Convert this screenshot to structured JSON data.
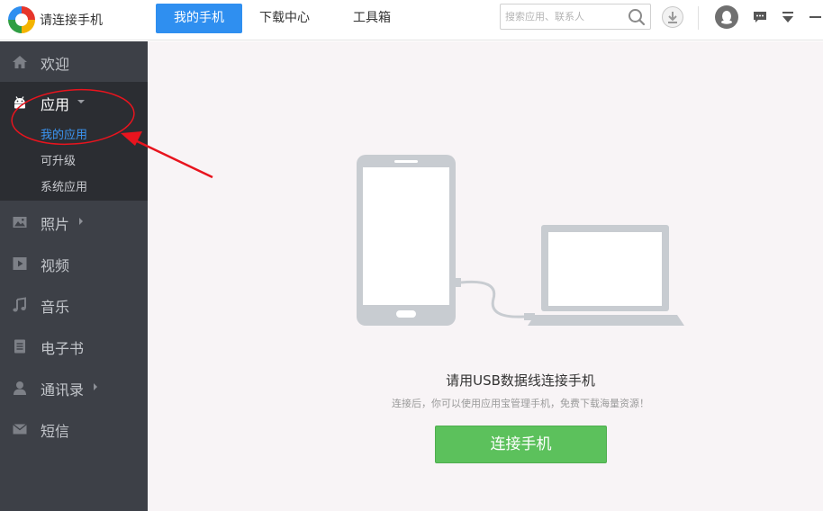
{
  "app": {
    "title": "请连接手机"
  },
  "nav": {
    "tabs": [
      {
        "label": "我的手机",
        "active": true
      },
      {
        "label": "下载中心",
        "active": false
      },
      {
        "label": "工具箱",
        "active": false
      }
    ]
  },
  "search": {
    "placeholder": "搜索应用、联系人",
    "icon": "search-icon"
  },
  "header_icons": [
    "download-icon",
    "qq-avatar-icon",
    "message-icon",
    "dropdown-menu-icon",
    "minimize-icon"
  ],
  "sidebar": {
    "items": [
      {
        "label": "欢迎",
        "icon": "home-icon"
      },
      {
        "label": "应用",
        "icon": "android-icon",
        "expanded": true
      },
      {
        "label": "照片",
        "icon": "image-icon",
        "has_submenu": true
      },
      {
        "label": "视频",
        "icon": "video-icon"
      },
      {
        "label": "音乐",
        "icon": "music-icon"
      },
      {
        "label": "电子书",
        "icon": "book-icon"
      },
      {
        "label": "通讯录",
        "icon": "contact-icon",
        "has_submenu": true
      },
      {
        "label": "短信",
        "icon": "sms-icon"
      }
    ],
    "app_subitems": [
      {
        "label": "我的应用",
        "active": true
      },
      {
        "label": "可升级",
        "active": false
      },
      {
        "label": "系统应用",
        "active": false
      }
    ]
  },
  "main": {
    "title": "请用USB数据线连接手机",
    "subtitle": "连接后，你可以使用应用宝管理手机，免费下载海量资源！",
    "button": "连接手机"
  },
  "colors": {
    "accent": "#2f8ff0",
    "sidebar_bg": "#3d4047",
    "button_green": "#5cc15c",
    "annotation_red": "#e8141e"
  }
}
